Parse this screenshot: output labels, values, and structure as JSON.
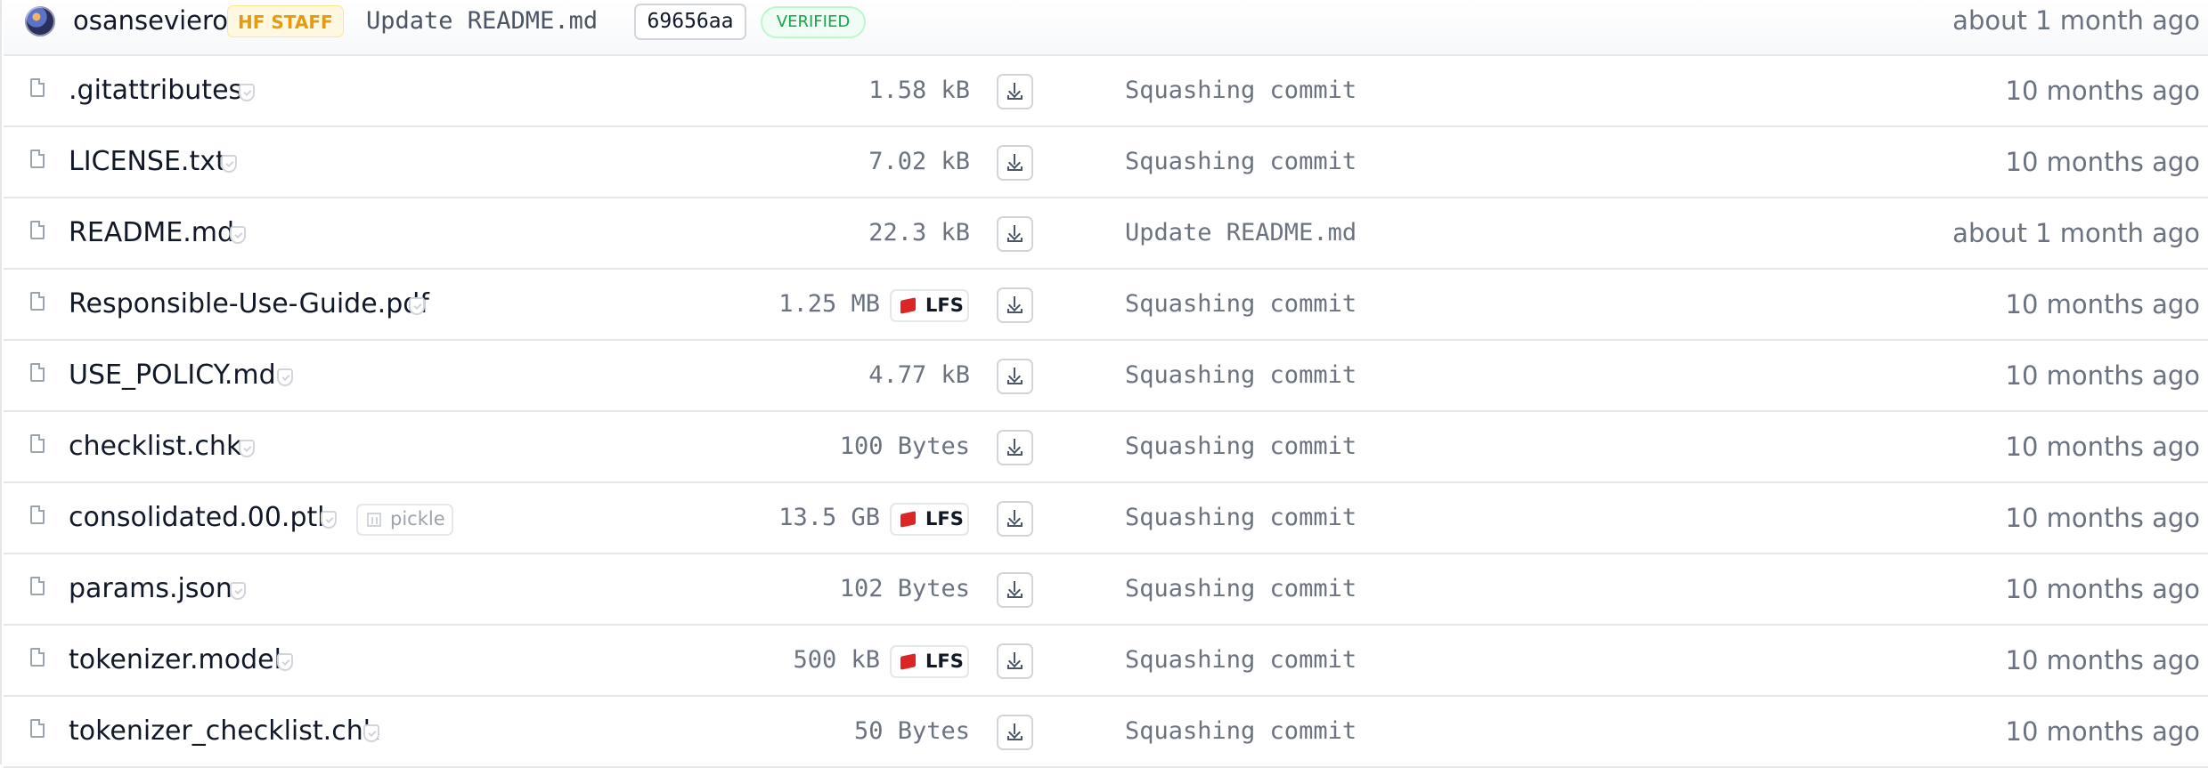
{
  "commit": {
    "author": "osanseviero",
    "badge": "HF STAFF",
    "message": "Update README.md",
    "sha": "69656aa",
    "verified": "VERIFIED",
    "date": "about 1 month ago"
  },
  "files": [
    {
      "name": ".gitattributes",
      "size": "1.58 kB",
      "lfs": false,
      "lfs_label": "",
      "pickle": false,
      "pickle_label": "",
      "commit": "Squashing commit",
      "date": "10 months ago"
    },
    {
      "name": "LICENSE.txt",
      "size": "7.02 kB",
      "lfs": false,
      "lfs_label": "",
      "pickle": false,
      "pickle_label": "",
      "commit": "Squashing commit",
      "date": "10 months ago"
    },
    {
      "name": "README.md",
      "size": "22.3 kB",
      "lfs": false,
      "lfs_label": "",
      "pickle": false,
      "pickle_label": "",
      "commit": "Update README.md",
      "date": "about 1 month ago"
    },
    {
      "name": "Responsible-Use-Guide.pdf",
      "size": "1.25 MB",
      "lfs": true,
      "lfs_label": "LFS",
      "pickle": false,
      "pickle_label": "",
      "commit": "Squashing commit",
      "date": "10 months ago"
    },
    {
      "name": "USE_POLICY.md",
      "size": "4.77 kB",
      "lfs": false,
      "lfs_label": "",
      "pickle": false,
      "pickle_label": "",
      "commit": "Squashing commit",
      "date": "10 months ago"
    },
    {
      "name": "checklist.chk",
      "size": "100 Bytes",
      "lfs": false,
      "lfs_label": "",
      "pickle": false,
      "pickle_label": "",
      "commit": "Squashing commit",
      "date": "10 months ago"
    },
    {
      "name": "consolidated.00.pth",
      "size": "13.5 GB",
      "lfs": true,
      "lfs_label": "LFS",
      "pickle": true,
      "pickle_label": "pickle",
      "commit": "Squashing commit",
      "date": "10 months ago"
    },
    {
      "name": "params.json",
      "size": "102 Bytes",
      "lfs": false,
      "lfs_label": "",
      "pickle": false,
      "pickle_label": "",
      "commit": "Squashing commit",
      "date": "10 months ago"
    },
    {
      "name": "tokenizer.model",
      "size": "500 kB",
      "lfs": true,
      "lfs_label": "LFS",
      "pickle": false,
      "pickle_label": "",
      "commit": "Squashing commit",
      "date": "10 months ago"
    },
    {
      "name": "tokenizer_checklist.chk",
      "size": "50 Bytes",
      "lfs": false,
      "lfs_label": "",
      "pickle": false,
      "pickle_label": "",
      "commit": "Squashing commit",
      "date": "10 months ago"
    }
  ],
  "icons": {
    "avatar": "user-avatar",
    "file": "file-icon",
    "safe": "safe-check-icon",
    "download": "download-icon",
    "lfs": "lfs-cube-icon",
    "pickle": "pickle-icon"
  },
  "colors": {
    "staff_badge": "#e39b12",
    "verified": "#16a34a",
    "lfs_icon": "#dc2626",
    "muted_text": "#6b7280"
  }
}
